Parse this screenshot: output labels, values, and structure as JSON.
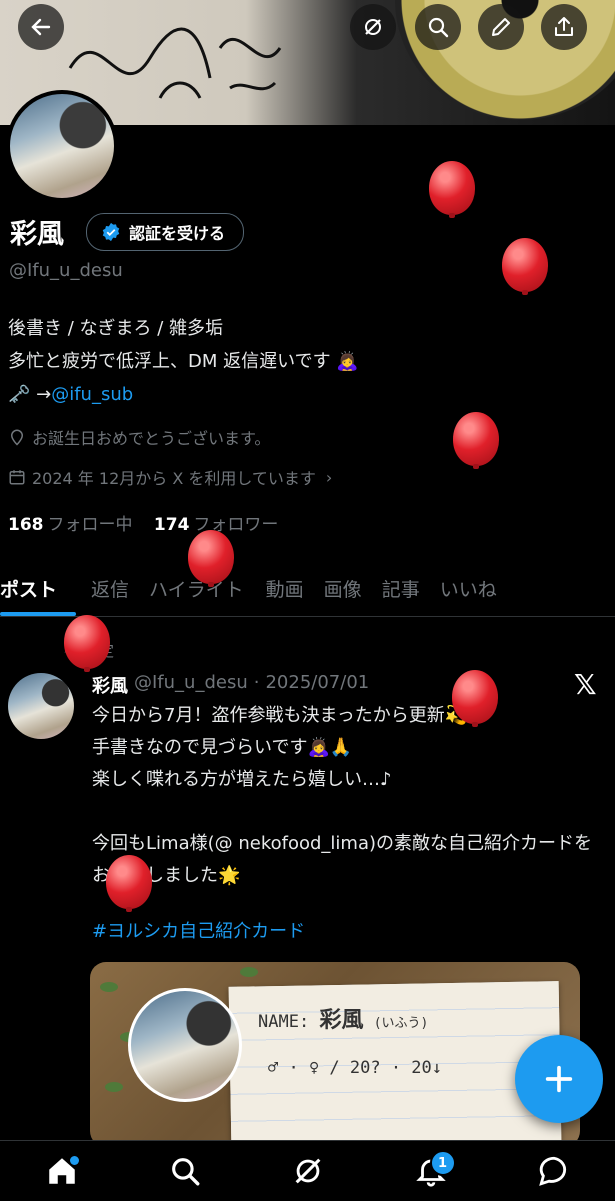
{
  "profile": {
    "name": "彩風",
    "verify_label": "認証を受ける",
    "handle": "@Ifu_u_desu",
    "bio_line1": "後書き / なぎまろ / 雑多垢",
    "bio_line2": "多忙と疲労で低浮上、DM 返信遅いです 🙇‍♀️",
    "bio_line3_prefix": "🗝️ →",
    "bio_link": "@ifu_sub",
    "birthday": "お誕生日おめでとうございます。",
    "joined": "2024 年 12月から X を利用しています",
    "following_count": "168",
    "following_label": "フォロー中",
    "followers_count": "174",
    "followers_label": "フォロワー"
  },
  "tabs": [
    "ポスト",
    "返信",
    "ハイライト",
    "動画",
    "画像",
    "記事",
    "いいね"
  ],
  "post": {
    "pinned_label": "固定",
    "author": "彩風",
    "handle": "@Ifu_u_desu",
    "sep": "·",
    "date": "2025/07/01",
    "body": "今日から7月！盗作参戦も決まったから更新💫\n手書きなので見づらいです🙇‍♀️🙏\n楽しく喋れる方が増えたら嬉しい…♪\n\n今回もLima様(@ nekofood_lima)の素敵な自己紹介カードをお借りしました🌟",
    "hashtag": "#ヨルシカ自己紹介カード",
    "card_name_label": "NAME:",
    "card_name_value": "彩風",
    "card_name_reading": "(いふう)",
    "card_age": "♂ · ♀ / 20? · 20↓"
  },
  "notifications_badge": "1",
  "icons": [
    "back-arrow-icon",
    "grok-icon",
    "search-icon",
    "edit-icon",
    "share-icon",
    "verified-badge-icon",
    "pin-icon",
    "location-icon",
    "calendar-icon",
    "x-logo-icon",
    "plus-icon",
    "home-icon",
    "grok-nav-icon",
    "bell-icon",
    "chat-icon"
  ],
  "colors": {
    "accent": "#1d9bf0",
    "muted": "#71767b",
    "balloon": "#e0202a"
  }
}
